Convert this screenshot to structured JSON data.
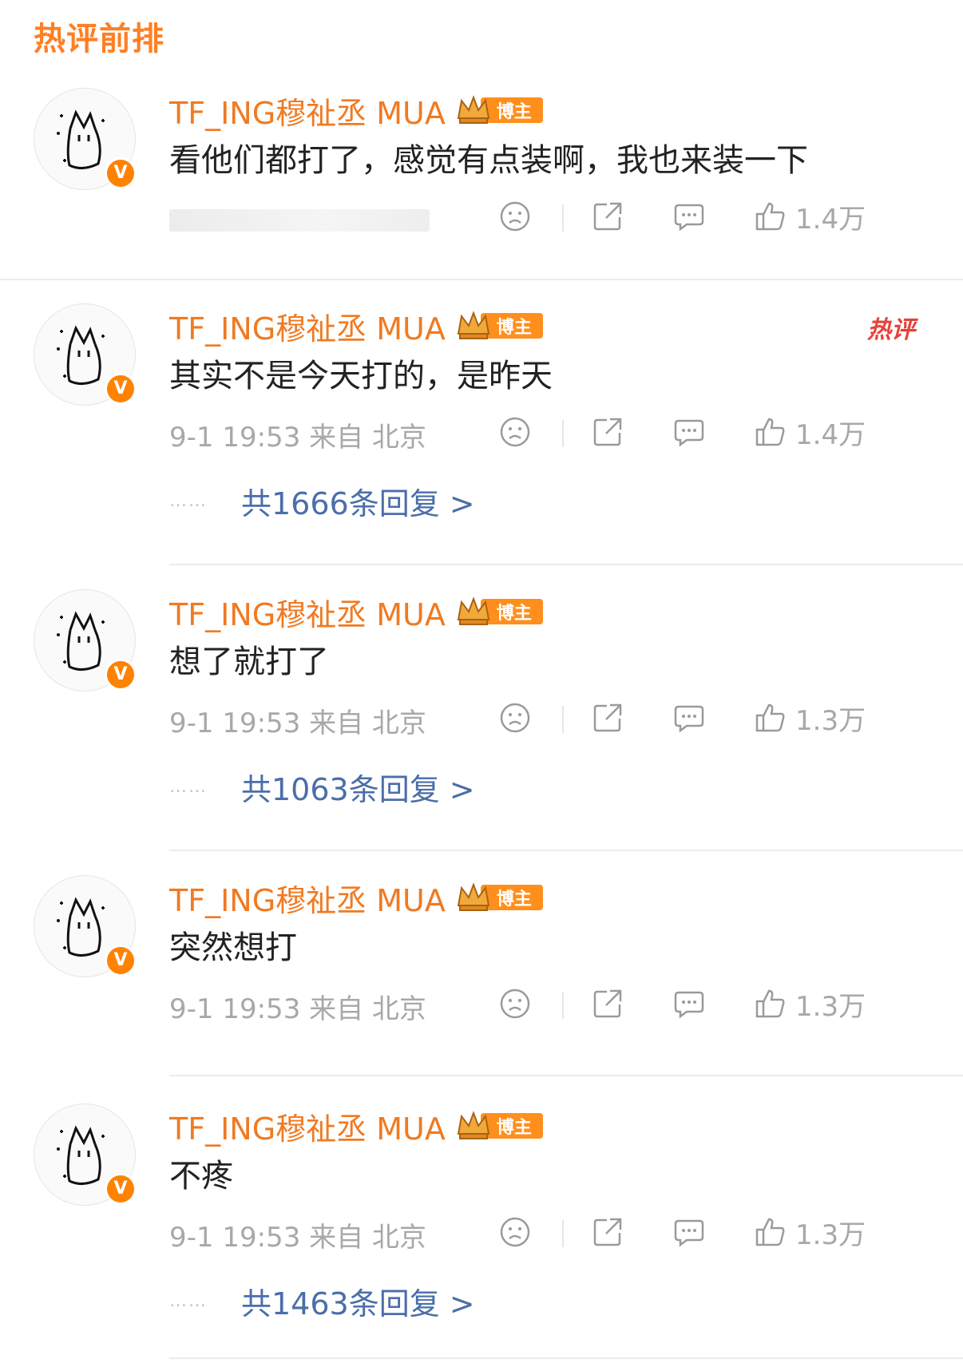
{
  "section_title": "热评前排",
  "colors": {
    "accent": "#ff7f24",
    "username": "#f07a21",
    "link": "#4a6ea9",
    "meta": "#a8a8a8",
    "hot": "#e8413b",
    "verified": "#ff8200"
  },
  "badge_label": "博主",
  "verified_mark": "V",
  "comments": [
    {
      "username": "TF_ING穆祉丞 MUA",
      "text": "看他们都打了，感觉有点装啊，我也来装一下",
      "meta": "",
      "likes": "1.4万",
      "replies": "",
      "hot": ""
    },
    {
      "username": "TF_ING穆祉丞 MUA",
      "text": "其实不是今天打的，是昨天",
      "meta": "9-1 19:53  来自 北京",
      "likes": "1.4万",
      "replies": "共1666条回复 >",
      "hot": "热评"
    },
    {
      "username": "TF_ING穆祉丞 MUA",
      "text": "想了就打了",
      "meta": "9-1 19:53  来自 北京",
      "likes": "1.3万",
      "replies": "共1063条回复 >",
      "hot": ""
    },
    {
      "username": "TF_ING穆祉丞 MUA",
      "text": "突然想打",
      "meta": "9-1 19:53  来自 北京",
      "likes": "1.3万",
      "replies": "",
      "hot": ""
    },
    {
      "username": "TF_ING穆祉丞 MUA",
      "text": "不疼",
      "meta": "9-1 19:53  来自 北京",
      "likes": "1.3万",
      "replies": "共1463条回复 >",
      "hot": ""
    }
  ],
  "reply_dots": "……",
  "icons": [
    "sad-face-icon",
    "share-icon",
    "comment-icon",
    "thumbs-up-icon",
    "crown-icon",
    "verified-icon"
  ]
}
